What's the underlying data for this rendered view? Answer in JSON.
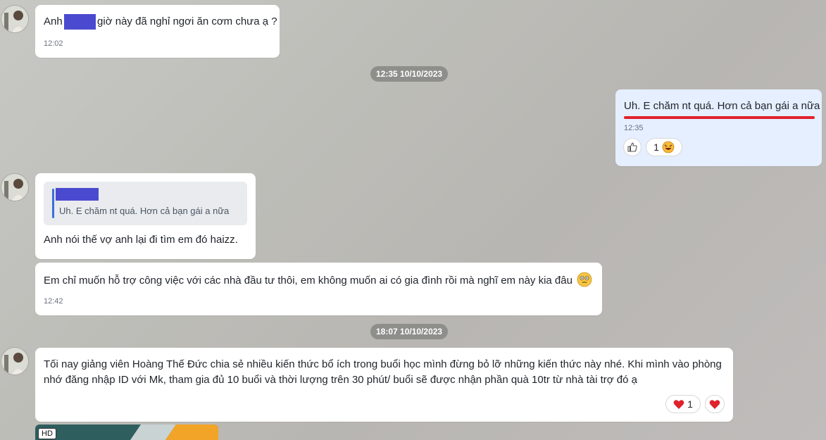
{
  "messages": {
    "m1": {
      "prefix": "Anh",
      "suffix": "giờ này đã nghỉ ngơi ăn cơm chưa ạ ?",
      "time": "12:02"
    },
    "sep1": "12:35 10/10/2023",
    "m2": {
      "text": "Uh. E chăm nt quá. Hơn cả bạn gái a nữa",
      "time": "12:35",
      "reaction_count": "1"
    },
    "m3": {
      "quote_text": "Uh. E chăm nt quá. Hơn cả bạn gái a nữa",
      "text": "Anh nói thế vợ anh lại đi tìm em đó haizz."
    },
    "m4": {
      "text": "Em chỉ muốn hỗ trợ công việc với các nhà đầu tư  thôi, em không muốn ai có gia đình rồi mà nghĩ em này kia đâu",
      "time": "12:42"
    },
    "sep2": "18:07 10/10/2023",
    "m5": {
      "line1": "Tối nay giảng viên Hoàng Thế Đức chia sẻ nhiều kiến thức bổ ích trong buổi học mình đừng bỏ lỡ những kiến thức này nhé. Khi mình vào phòng",
      "line2": "nhớ đăng nhập ID với Mk, tham gia đủ 10 buổi và thời lượng trên 30 phút/ buổi sẽ được nhận phần quà 10tr từ nhà tài trợ đó ạ",
      "reaction_count": "1"
    },
    "video_badge": "HD"
  },
  "colors": {
    "redact": "#4a4ad0",
    "underline": "#e0222c",
    "my_bubble": "#e5efff",
    "heart": "#e0222c"
  }
}
